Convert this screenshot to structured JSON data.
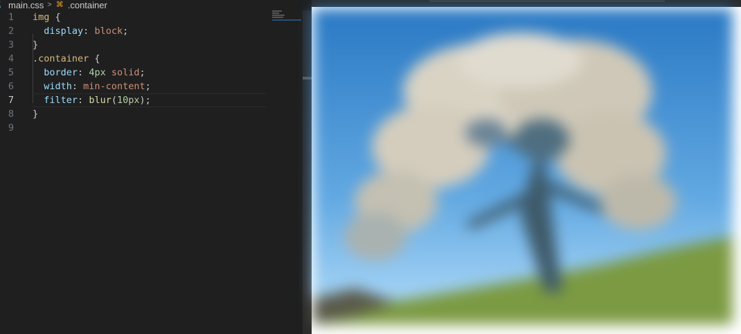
{
  "breadcrumb": {
    "file_icon": "css-file-icon",
    "file_name": "main.css",
    "separator": ">",
    "symbol_icon": "css-selector-icon",
    "symbol_name": ".container"
  },
  "editor": {
    "line_numbers": [
      "1",
      "2",
      "3",
      "4",
      "5",
      "6",
      "7",
      "8",
      "9"
    ],
    "active_line": "7",
    "lines": {
      "l1": {
        "selector": "img",
        "brace": " {"
      },
      "l2": {
        "prop": "display",
        "colon": ": ",
        "value": "block",
        "semi": ";"
      },
      "l3": {
        "brace": "}"
      },
      "l4": {
        "selector": ".container",
        "brace": " {"
      },
      "l5": {
        "prop": "border",
        "colon": ": ",
        "num": "4px",
        "sp": " ",
        "value": "solid",
        "semi": ";"
      },
      "l6": {
        "prop": "width",
        "colon": ": ",
        "value": "min-content",
        "semi": ";"
      },
      "l7": {
        "prop": "filter",
        "colon": ": ",
        "fn": "blur",
        "open": "(",
        "num": "10px",
        "close": ")",
        "semi": ";"
      },
      "l8": {
        "brace": "}"
      }
    }
  },
  "colors": {
    "editor_bg": "#1f1f1f",
    "selector": "#d7ba7d",
    "property": "#9cdcfe",
    "value": "#ce9178",
    "number": "#b5cea8",
    "function": "#dcdcaa",
    "sky_top": "#2a79c4",
    "sky_bottom": "#9fd2f0",
    "grass": "#6f8a3a"
  },
  "preview": {
    "image_description_icon": "blurred-tree-photo"
  }
}
